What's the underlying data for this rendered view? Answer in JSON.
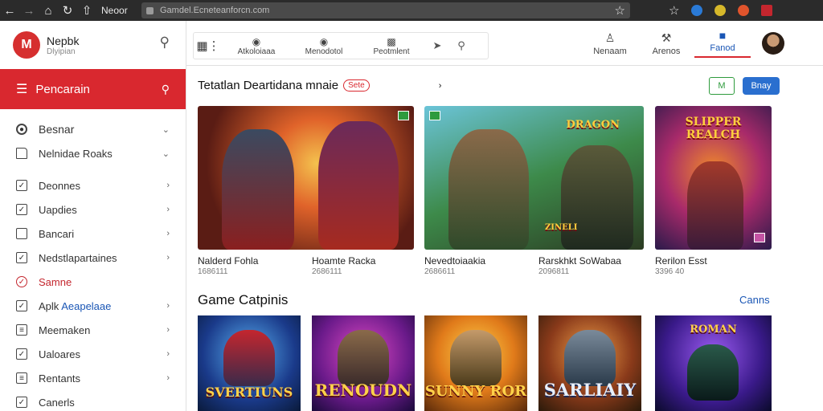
{
  "browser": {
    "tab_title": "Neoor",
    "url": "Gamdel.Ecneteanforcn.com",
    "icons": [
      "back-arrow-icon",
      "forward-arrow-icon",
      "home-icon",
      "reload-icon",
      "star-icon",
      "bookmark-star-icon",
      "extension-icon"
    ]
  },
  "sidebar": {
    "brand_name": "Nepbk",
    "brand_sub": "Dlyipian",
    "search_label": "Pencarain",
    "items": [
      {
        "label": "Besnar",
        "kind": "circle"
      },
      {
        "label": "Nelnidae  Roaks",
        "kind": "folder"
      },
      {
        "label": "Deonnes",
        "kind": "check"
      },
      {
        "label": "Uapdies",
        "kind": "check"
      },
      {
        "label": "Bancari",
        "kind": "empty"
      },
      {
        "label": "Nedstlapartaines",
        "kind": "check"
      },
      {
        "label": "Samne",
        "kind": "active"
      },
      {
        "label": "Aplk",
        "label_accent": "Aeapelaae",
        "kind": "check"
      },
      {
        "label": "Meemaken",
        "kind": "doc"
      },
      {
        "label": "Ualoares",
        "kind": "check"
      },
      {
        "label": "Rentants",
        "kind": "doc"
      },
      {
        "label": "Canerls",
        "kind": "check"
      }
    ]
  },
  "toolbar": {
    "buttons": [
      "Atkoloiaaa",
      "Menodotol",
      "Peotmlent"
    ],
    "right_items": [
      "Nenaam",
      "Arenos",
      "Fanod"
    ]
  },
  "section1": {
    "title": "Tetatlan Deartidana mnaie",
    "badge": "Sete",
    "green_button": "M",
    "blue_button": "Bnay",
    "cards": [
      {
        "name": "Nalderd Fohla",
        "num": "1686111"
      },
      {
        "name": "Hoamte  Racka",
        "num": "2686111"
      },
      {
        "name": "Nevedtoiaakia",
        "num": "2686611",
        "art": "DRAGON"
      },
      {
        "name": "Rarskhkt SoWabaa",
        "num": "2096811",
        "art": "ZINELI"
      },
      {
        "name": "Rerilon Esst",
        "num": "3396 40",
        "art": "SLIPPER REALCH"
      }
    ]
  },
  "section2": {
    "title": "Game Catpinis",
    "link": "Canns",
    "tiles": [
      "SVERTIUNS",
      "RENOUDN",
      "SUNNY ROR",
      "SARLIAIY",
      "ROMAN"
    ]
  },
  "colors": {
    "accent_red": "#d9282f",
    "accent_blue": "#1a56b5",
    "accent_green": "#2e9b3d"
  }
}
